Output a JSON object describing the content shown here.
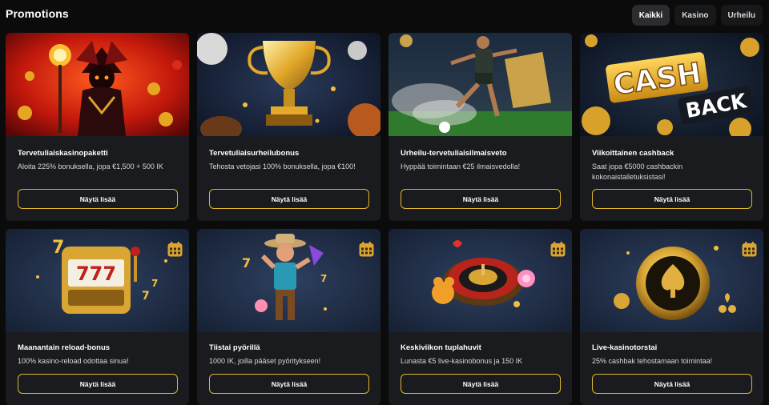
{
  "header": {
    "title": "Promotions",
    "filters": [
      {
        "label": "Kaikki",
        "active": true
      },
      {
        "label": "Kasino",
        "active": false
      },
      {
        "label": "Urheilu",
        "active": false
      }
    ]
  },
  "promotions": [
    {
      "title": "Tervetuliaiskasinopaketti",
      "description": "Aloita 225% bonuksella, jopa €1,500 + 500 IK",
      "cta": "Näytä lisää",
      "image": "joker-fire-icon"
    },
    {
      "title": "Tervetuliaisurheilubonus",
      "description": "Tehosta vetojasi 100% bonuksella, jopa €100!",
      "cta": "Näytä lisää",
      "image": "trophy-icon"
    },
    {
      "title": "Urheilu-tervetuliaisilmaisveto",
      "description": "Hyppää toimintaan €25 ilmaisvedolla!",
      "cta": "Näytä lisää",
      "image": "football-player-icon"
    },
    {
      "title": "Viikoittainen cashback",
      "description": "Saat jopa €5000 cashbackin kokonaistalletuksistasi!",
      "cta": "Näytä lisää",
      "image": "cashback-icon",
      "art_text": [
        "CASH",
        "BACK"
      ]
    },
    {
      "title": "Maanantain reload-bonus",
      "description": "100% kasino-reload odottaa sinua!",
      "cta": "Näytä lisää",
      "image": "slot-machine-icon",
      "art_text": [
        "777"
      ]
    },
    {
      "title": "Tiistai pyörillä",
      "description": "1000 IK, joilla pääset pyöritykseen!",
      "cta": "Näytä lisää",
      "image": "cowboy-icon"
    },
    {
      "title": "Keskiviikon tuplahuvit",
      "description": "Lunasta €5 live-kasinobonus ja 150 IK",
      "cta": "Näytä lisää",
      "image": "roulette-icon"
    },
    {
      "title": "Live-kasinotorstai",
      "description": "25% cashbak tehostamaan toimintaa!",
      "cta": "Näytä lisää",
      "image": "spade-chip-icon"
    }
  ],
  "colors": {
    "background": "#0b0b0c",
    "card": "#1a1b1e",
    "accent": "#e1b52c",
    "text_muted": "#d7d7d7"
  }
}
